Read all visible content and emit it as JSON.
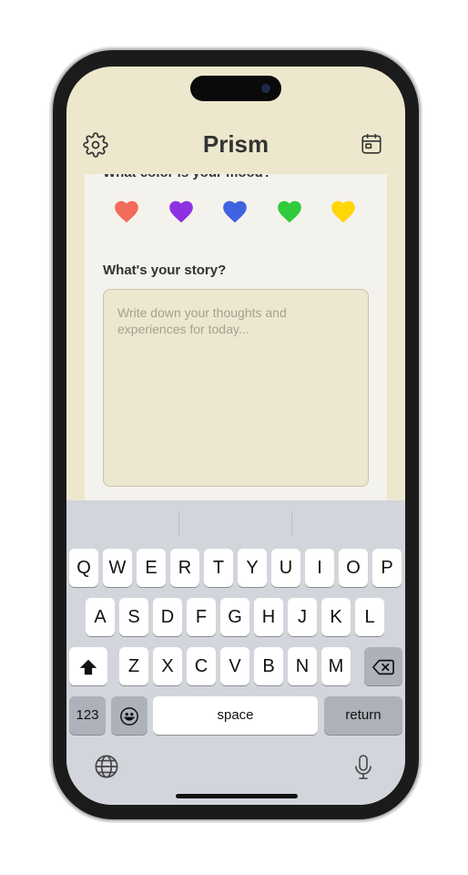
{
  "app": {
    "title": "Prism"
  },
  "icons": {
    "settings": "gear-icon",
    "calendar": "calendar-icon",
    "globe": "globe-icon",
    "mic": "microphone-icon",
    "shift": "shift-icon",
    "backspace": "backspace-icon",
    "emoji": "emoji-icon"
  },
  "mood": {
    "question": "What color is your mood?",
    "colors": [
      {
        "name": "red",
        "hex": "#f36b5a"
      },
      {
        "name": "purple",
        "hex": "#8d32e0"
      },
      {
        "name": "blue",
        "hex": "#3f63e0"
      },
      {
        "name": "green",
        "hex": "#2fcb3a"
      },
      {
        "name": "yellow",
        "hex": "#ffd60a"
      }
    ]
  },
  "story": {
    "label": "What's your story?",
    "placeholder": "Write down your thoughts and experiences for today..."
  },
  "keyboard": {
    "row1": [
      "Q",
      "W",
      "E",
      "R",
      "T",
      "Y",
      "U",
      "I",
      "O",
      "P"
    ],
    "row2": [
      "A",
      "S",
      "D",
      "F",
      "G",
      "H",
      "J",
      "K",
      "L"
    ],
    "row3": [
      "Z",
      "X",
      "C",
      "V",
      "B",
      "N",
      "M"
    ],
    "numbers_label": "123",
    "space_label": "space",
    "return_label": "return"
  }
}
